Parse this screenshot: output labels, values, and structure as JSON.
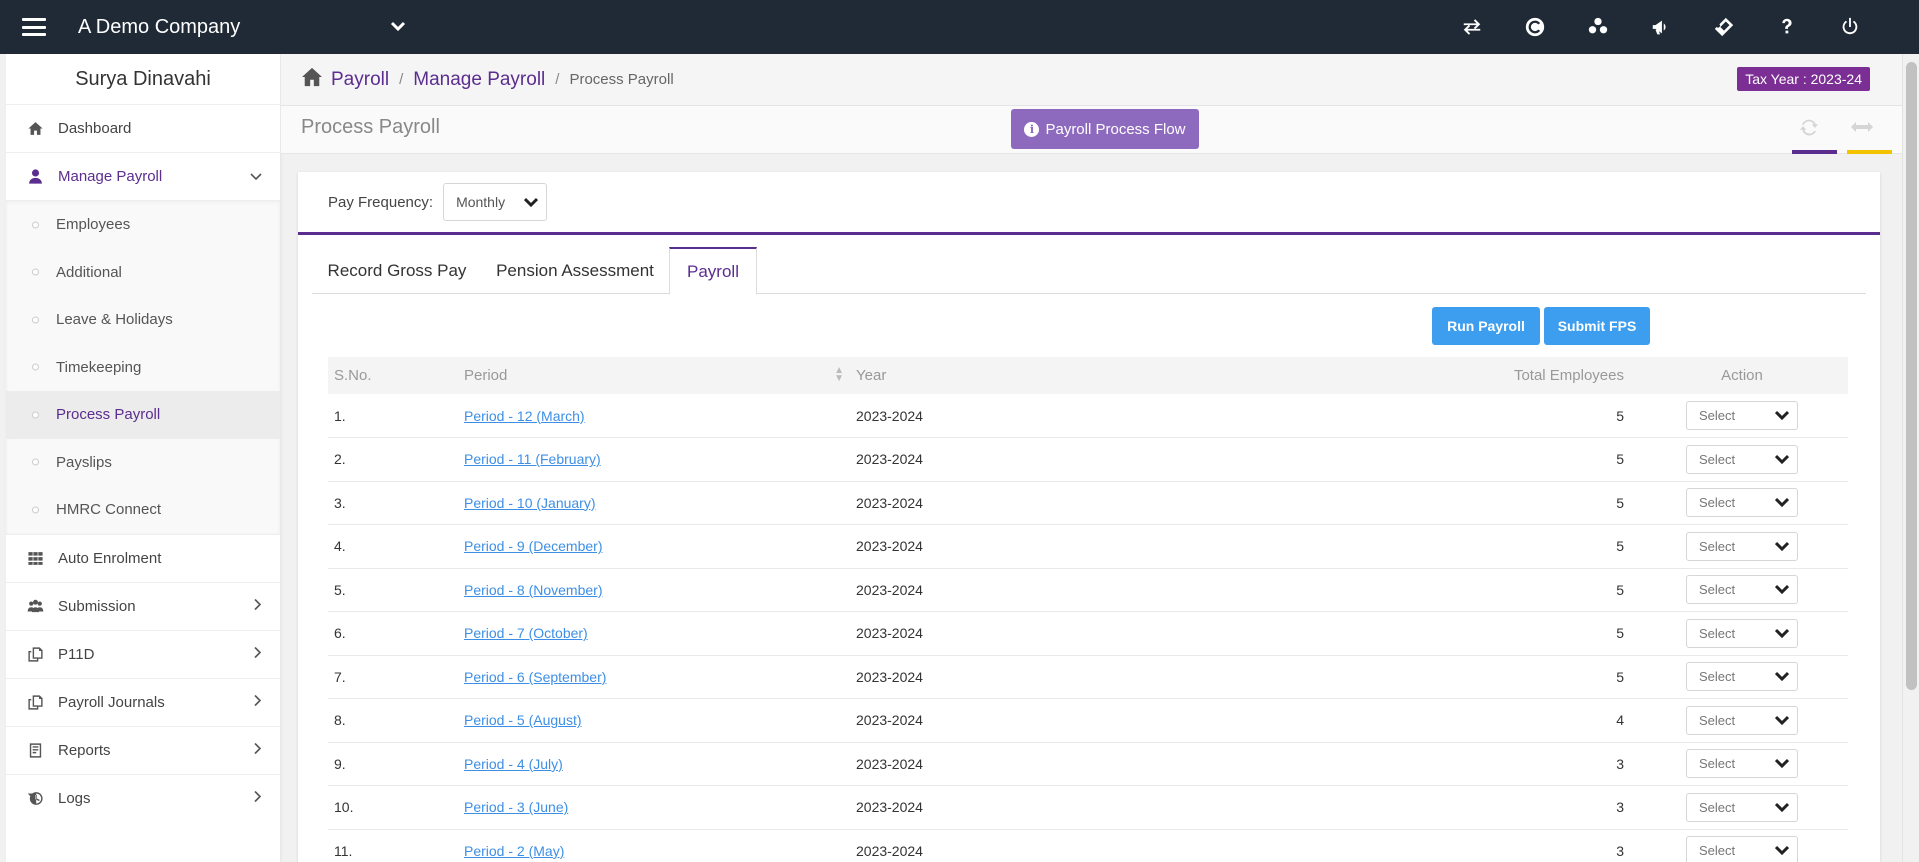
{
  "topbar": {
    "company": "A Demo Company",
    "icons": [
      "switch-icon",
      "copyright-icon",
      "bitbucket-icon",
      "megaphone-icon",
      "ticket-icon",
      "help-icon",
      "power-icon"
    ]
  },
  "sidebar": {
    "user": "Surya Dinavahi",
    "items": [
      {
        "label": "Dashboard"
      },
      {
        "label": "Manage Payroll"
      },
      {
        "label": "Auto Enrolment"
      },
      {
        "label": "Submission"
      },
      {
        "label": "P11D"
      },
      {
        "label": "Payroll Journals"
      },
      {
        "label": "Reports"
      },
      {
        "label": "Logs"
      }
    ],
    "sub_items": [
      {
        "label": "Employees"
      },
      {
        "label": "Additional"
      },
      {
        "label": "Leave & Holidays"
      },
      {
        "label": "Timekeeping"
      },
      {
        "label": "Process Payroll"
      },
      {
        "label": "Payslips"
      },
      {
        "label": "HMRC Connect"
      }
    ]
  },
  "breadcrumb": {
    "items": [
      "Payroll",
      "Manage Payroll"
    ],
    "current": "Process Payroll"
  },
  "tax_year": "Tax Year : 2023-24",
  "page": {
    "title": "Process Payroll",
    "flow_button": "Payroll Process Flow"
  },
  "filters": {
    "pay_frequency_label": "Pay Frequency:",
    "pay_frequency_value": "Monthly"
  },
  "tabs": [
    "Record Gross Pay",
    "Pension Assessment",
    "Payroll"
  ],
  "active_tab": "Payroll",
  "actions": {
    "run_payroll": "Run Payroll",
    "submit_fps": "Submit FPS"
  },
  "table": {
    "headers": [
      "S.No.",
      "Period",
      "Year",
      "Total Employees",
      "Action"
    ],
    "select_placeholder": "Select",
    "rows": [
      {
        "sno": "1.",
        "period": "Period - 12 (March)",
        "year": "2023-2024",
        "total": "5"
      },
      {
        "sno": "2.",
        "period": "Period - 11 (February)",
        "year": "2023-2024",
        "total": "5"
      },
      {
        "sno": "3.",
        "period": "Period - 10 (January)",
        "year": "2023-2024",
        "total": "5"
      },
      {
        "sno": "4.",
        "period": "Period - 9 (December)",
        "year": "2023-2024",
        "total": "5"
      },
      {
        "sno": "5.",
        "period": "Period - 8 (November)",
        "year": "2023-2024",
        "total": "5"
      },
      {
        "sno": "6.",
        "period": "Period - 7 (October)",
        "year": "2023-2024",
        "total": "5"
      },
      {
        "sno": "7.",
        "period": "Period - 6 (September)",
        "year": "2023-2024",
        "total": "5"
      },
      {
        "sno": "8.",
        "period": "Period - 5 (August)",
        "year": "2023-2024",
        "total": "4"
      },
      {
        "sno": "9.",
        "period": "Period - 4 (July)",
        "year": "2023-2024",
        "total": "3"
      },
      {
        "sno": "10.",
        "period": "Period - 3 (June)",
        "year": "2023-2024",
        "total": "3"
      },
      {
        "sno": "11.",
        "period": "Period - 2 (May)",
        "year": "2023-2024",
        "total": "3"
      }
    ]
  },
  "colors": {
    "topbar": "#1f2a36",
    "accent": "#5b2d8f",
    "tax_badge": "#7b2e93",
    "primary_button": "#3d9ef0",
    "link": "#3d8fe6"
  }
}
